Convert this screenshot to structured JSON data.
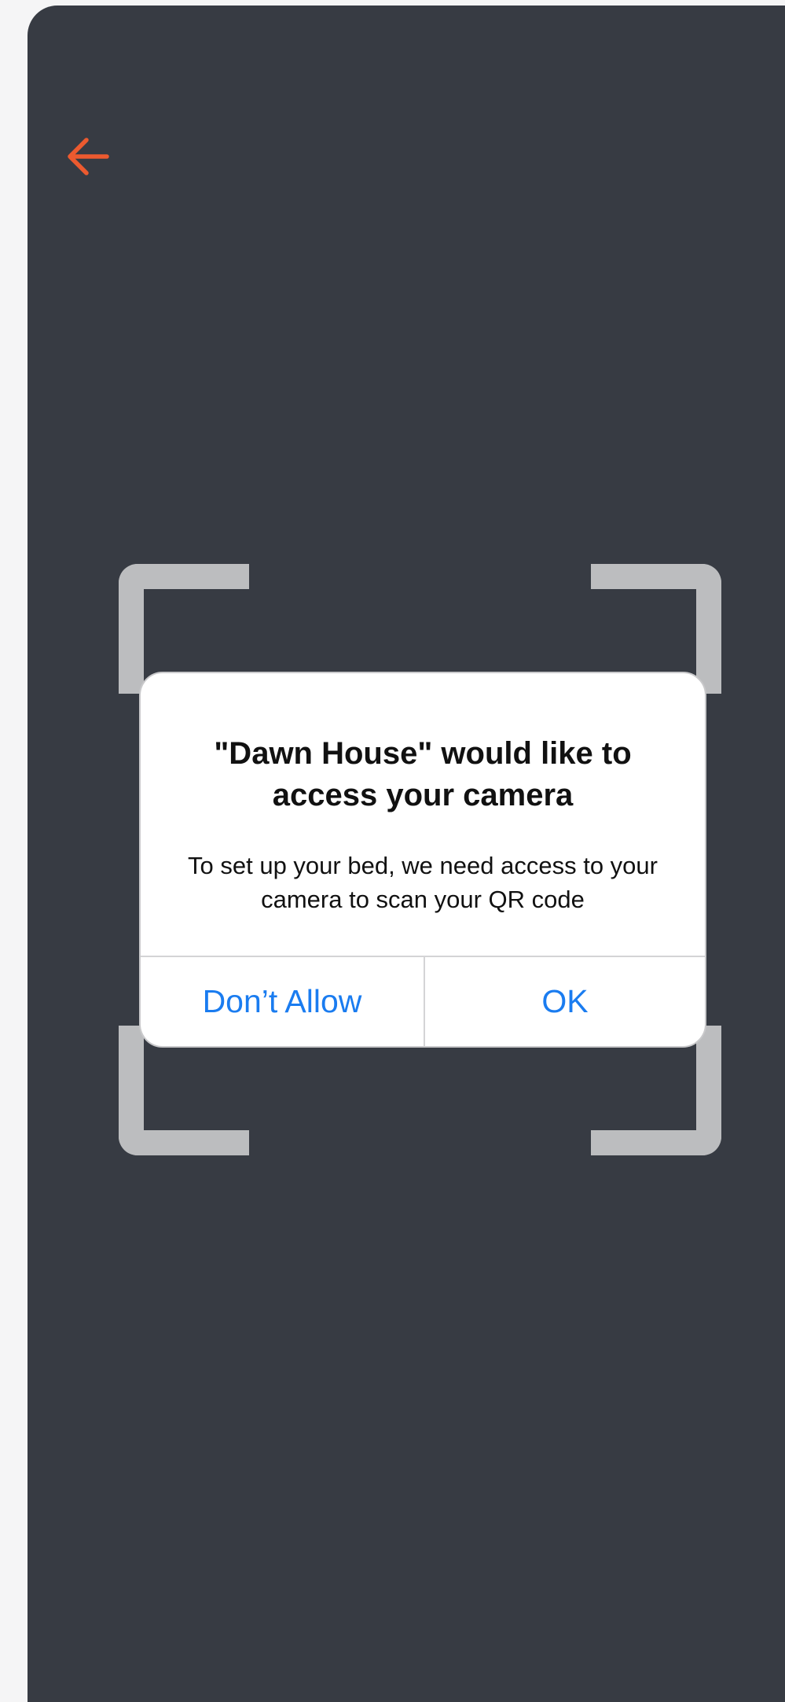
{
  "header": {
    "back_icon": "arrow-left-icon",
    "accent_color": "#ec5a2f"
  },
  "scanner": {
    "frame_color": "#bcbdbf",
    "background_color": "#373b43"
  },
  "permission_dialog": {
    "title": "\"Dawn House\" would like to\naccess your camera",
    "message": "To set up your bed, we need access to your\ncamera to scan your QR code",
    "deny_label": "Don’t Allow",
    "allow_label": "OK",
    "button_color": "#1a7cf0"
  }
}
